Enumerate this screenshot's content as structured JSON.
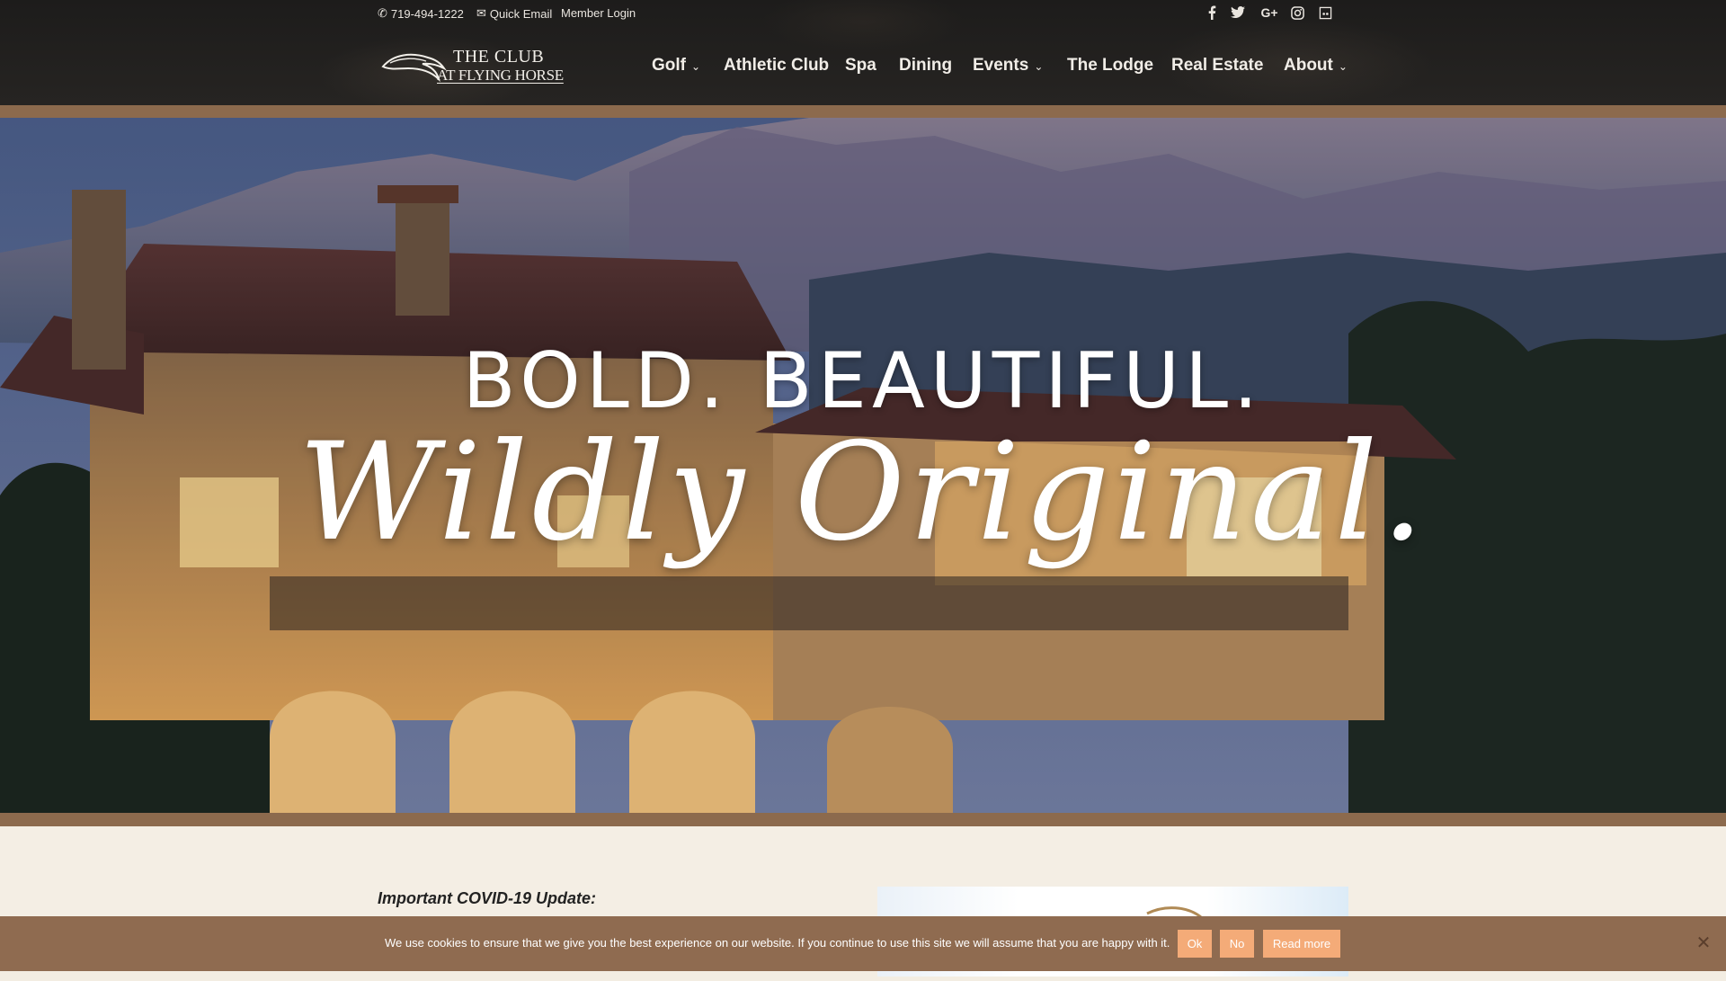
{
  "topbar": {
    "phone": "719-494-1222",
    "quick_email": "Quick Email",
    "member_login": "Member Login",
    "social_icons": [
      "facebook-icon",
      "twitter-icon",
      "google-plus-icon",
      "instagram-icon",
      "tripadvisor-icon"
    ]
  },
  "logo": {
    "title": "THE CLUB",
    "subtitle": "AT FLYING HORSE"
  },
  "nav": {
    "items": [
      {
        "label": "Golf",
        "has_dropdown": true
      },
      {
        "label": "Athletic Club",
        "has_dropdown": false
      },
      {
        "label": "Spa",
        "has_dropdown": false
      },
      {
        "label": "Dining",
        "has_dropdown": false
      },
      {
        "label": "Events",
        "has_dropdown": true
      },
      {
        "label": "The Lodge",
        "has_dropdown": false
      },
      {
        "label": "Real Estate",
        "has_dropdown": false
      },
      {
        "label": "About",
        "has_dropdown": true
      }
    ]
  },
  "hero": {
    "headline": "BOLD. BEAUTIFUL.",
    "script": "Wildly Original."
  },
  "content": {
    "covid_heading": "Important COVID-19 Update:"
  },
  "cookie": {
    "text": "We use cookies to ensure that we give you the best experience on our website. If you continue to use this site we will assume that you are happy with it.",
    "ok": "Ok",
    "no": "No",
    "read_more": "Read more"
  },
  "colors": {
    "header_bg": "#222120",
    "accent_brown": "#8c6a4d",
    "cookie_button": "#f4ab78",
    "content_bg": "#f4eee4"
  }
}
